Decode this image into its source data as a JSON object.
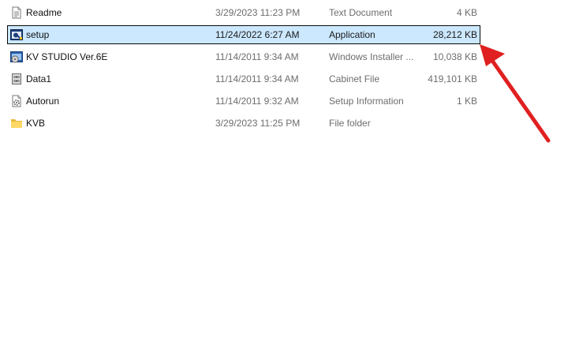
{
  "files": [
    {
      "name": "Readme",
      "date": "3/29/2023 11:23 PM",
      "type": "Text Document",
      "size": "4 KB",
      "icon": "text-document-icon"
    },
    {
      "name": "setup",
      "date": "11/24/2022 6:27 AM",
      "type": "Application",
      "size": "28,212 KB",
      "icon": "application-icon",
      "selected": true
    },
    {
      "name": "KV STUDIO Ver.6E",
      "date": "11/14/2011 9:34 AM",
      "type": "Windows Installer ...",
      "size": "10,038 KB",
      "icon": "installer-icon"
    },
    {
      "name": "Data1",
      "date": "11/14/2011 9:34 AM",
      "type": "Cabinet File",
      "size": "419,101 KB",
      "icon": "cabinet-icon"
    },
    {
      "name": "Autorun",
      "date": "11/14/2011 9:32 AM",
      "type": "Setup Information",
      "size": "1 KB",
      "icon": "setup-info-icon"
    },
    {
      "name": "KVB",
      "date": "3/29/2023 11:25 PM",
      "type": "File folder",
      "size": "",
      "icon": "folder-icon"
    }
  ],
  "annotation": {
    "color": "#e02020",
    "icon": "red-arrow-icon"
  },
  "colors": {
    "selection": "#cce8ff",
    "muted_text": "#6d6d6d"
  }
}
